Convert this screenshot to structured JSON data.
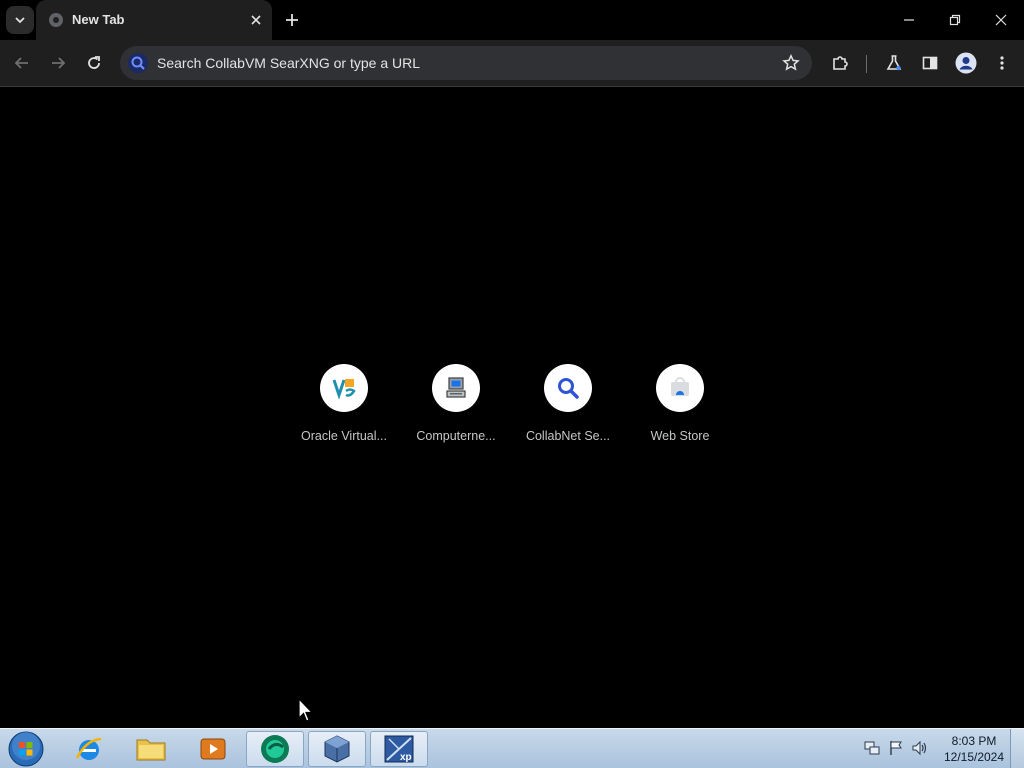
{
  "tab": {
    "title": "New Tab",
    "favicon": "chrome-globe-icon",
    "close": "close-icon"
  },
  "window_controls": [
    "minimize-icon",
    "restore-icon",
    "close-icon"
  ],
  "toolbar": {
    "back": "back-arrow-icon",
    "forward": "forward-arrow-icon",
    "reload": "reload-icon",
    "omnibox_placeholder": "Search CollabVM SearXNG or type a URL",
    "bookmark": "star-icon",
    "extensions": "puzzle-icon",
    "labs": "flask-icon",
    "side_panel": "side-panel-icon",
    "profile": "profile-avatar-icon",
    "menu": "kebab-menu-icon"
  },
  "shortcuts": [
    {
      "label": "Oracle Virtual...",
      "icon": "virtualbox-icon"
    },
    {
      "label": "Computerne...",
      "icon": "computer-icon"
    },
    {
      "label": "CollabNet Se...",
      "icon": "magnifier-icon"
    },
    {
      "label": "Web Store",
      "icon": "webstore-icon"
    }
  ],
  "taskbar": {
    "start": "windows-orb-icon",
    "apps": [
      {
        "name": "Internet Explorer",
        "icon": "ie-icon",
        "running": false
      },
      {
        "name": "Windows Explorer",
        "icon": "folder-icon",
        "running": false
      },
      {
        "name": "Windows Media Player",
        "icon": "media-player-icon",
        "running": false
      },
      {
        "name": "Browser",
        "icon": "browser-icon",
        "running": true
      },
      {
        "name": "VirtualBox",
        "icon": "virtualbox-icon",
        "running": true
      },
      {
        "name": "Windows XP VM",
        "icon": "xp-icon",
        "running": true
      }
    ],
    "tray": [
      "network-icon",
      "flag-icon",
      "volume-icon"
    ],
    "clock": {
      "time": "8:03 PM",
      "date": "12/15/2024"
    }
  },
  "colors": {
    "chrome_dark": "#1f1f1f",
    "omnibox": "#303134",
    "accent_blue": "#2f54d6",
    "taskbar": "#b9cfe6"
  }
}
